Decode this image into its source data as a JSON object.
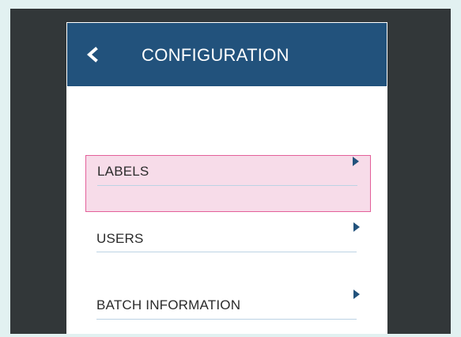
{
  "header": {
    "title": "CONFIGURATION",
    "back_icon": "chevron-left-icon"
  },
  "menu": {
    "items": [
      {
        "label": "LABELS",
        "selected": true,
        "arrow_icon": "caret-right-icon"
      },
      {
        "label": "USERS",
        "selected": false,
        "arrow_icon": "caret-right-icon"
      },
      {
        "label": "BATCH INFORMATION",
        "selected": false,
        "arrow_icon": "caret-right-icon"
      }
    ]
  },
  "colors": {
    "page_background": "#e2f1f1",
    "frame_background": "#323739",
    "header_background": "#22527c",
    "selected_background": "#f7dce9",
    "selected_border": "#e3609a",
    "arrow": "#22527c",
    "divider": "#bcd3e4"
  }
}
